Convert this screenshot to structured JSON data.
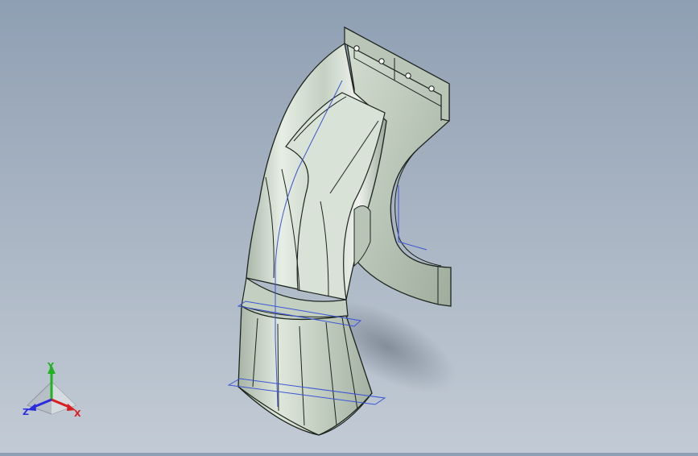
{
  "viewport": {
    "background_top": "#8f9fb3",
    "background_bottom": "#c2cbd5",
    "model_color": "#c6d2c4",
    "edge_color": "#1d241d",
    "sketch_line_color": "#3a55d6"
  },
  "triad": {
    "x_label": "X",
    "y_label": "Y",
    "z_label": "Z",
    "x_color": "#d81e1e",
    "y_color": "#1fb31f",
    "z_color": "#2a2adf"
  }
}
